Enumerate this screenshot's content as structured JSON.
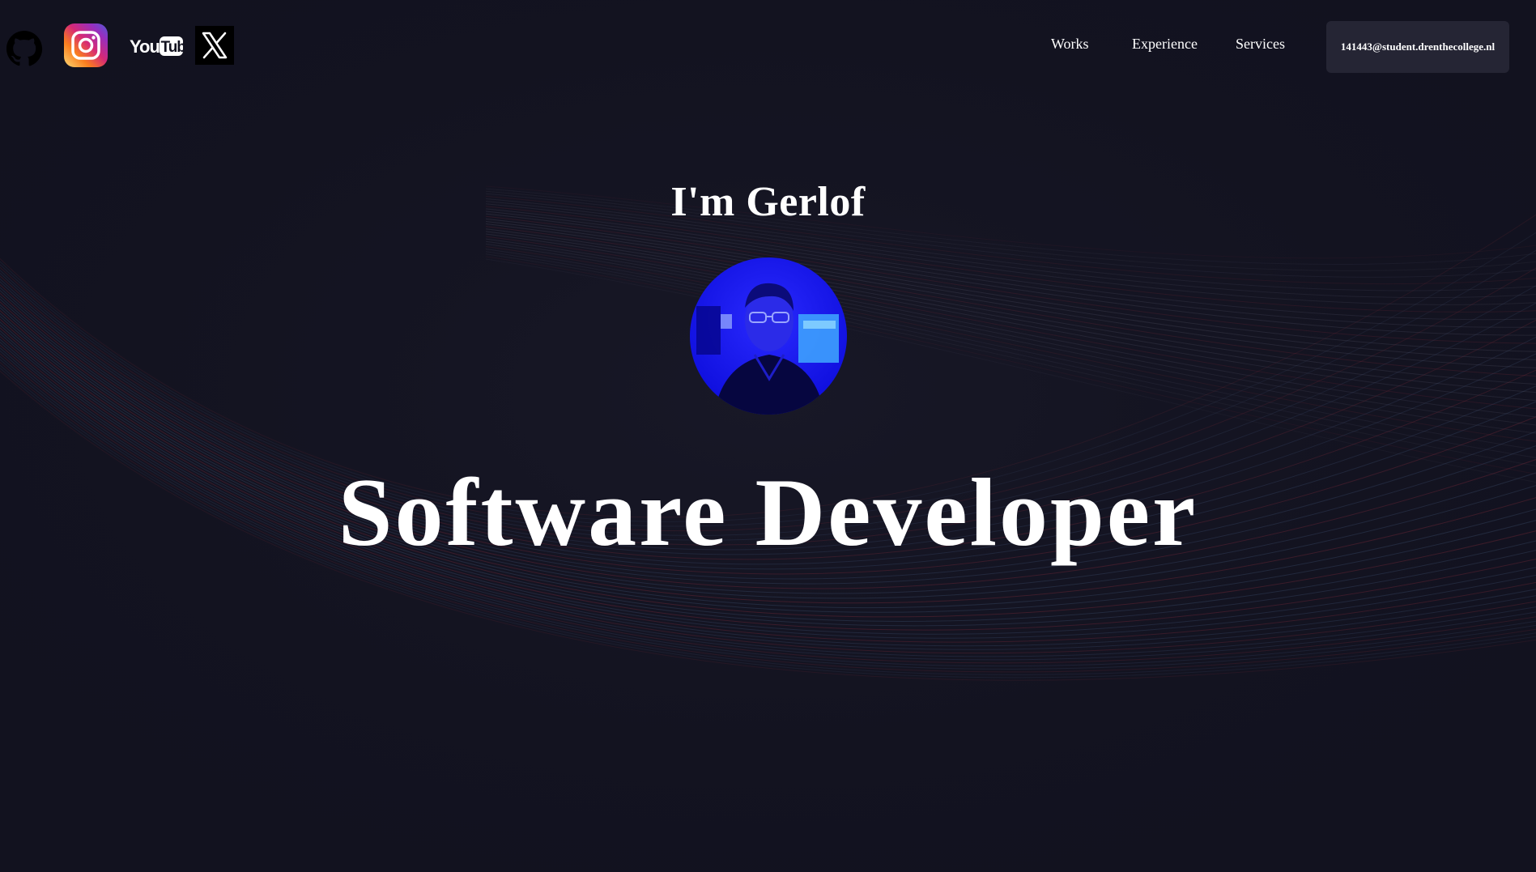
{
  "header": {
    "social": [
      {
        "name": "github-icon"
      },
      {
        "name": "instagram-icon"
      },
      {
        "name": "youtube-icon",
        "text": "YouTube"
      },
      {
        "name": "x-icon"
      }
    ],
    "nav": {
      "works": "Works",
      "experience": "Experience",
      "services": "Services"
    },
    "email": "141443@student.drenthecollege.nl"
  },
  "hero": {
    "greeting": "I'm Gerlof",
    "title": "Software Developer"
  },
  "colors": {
    "background": "#12121f",
    "email_button": "#252534",
    "wave_red": "#7a2a3a",
    "wave_blue": "#3a4a6a",
    "avatar_blue": "#1a1aff"
  }
}
